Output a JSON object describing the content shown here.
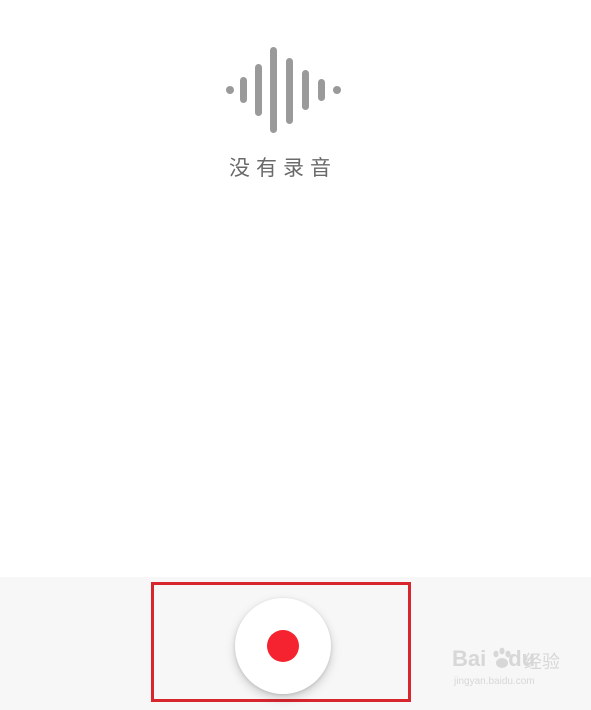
{
  "main": {
    "empty_state_icon": "waveform-icon",
    "empty_state_text": "没有录音"
  },
  "bottom_bar": {
    "record_button_icon": "record-dot-icon",
    "record_color": "#f5232f",
    "highlight_color": "#d8262f"
  },
  "watermark": {
    "brand_text": "Bai",
    "brand_text_2": "du",
    "cn_text": "经验",
    "url": "jingyan.baidu.com"
  }
}
